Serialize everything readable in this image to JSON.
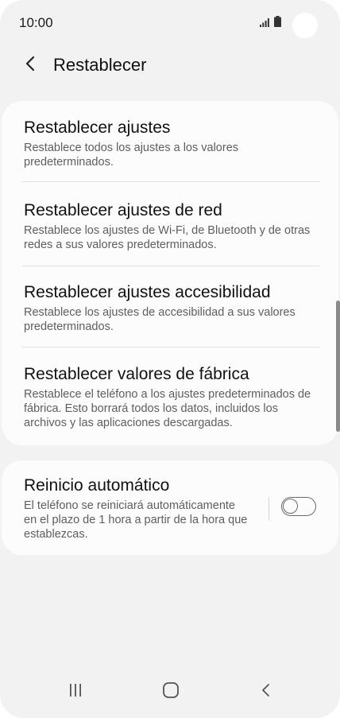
{
  "status_bar": {
    "time": "10:00",
    "icons": [
      "signal-icon",
      "battery-icon"
    ]
  },
  "header": {
    "back_icon": "chevron-left-icon",
    "title": "Restablecer"
  },
  "reset_options": [
    {
      "title": "Restablecer ajustes",
      "description": "Restablece todos los ajustes a los valores predeterminados."
    },
    {
      "title": "Restablecer ajustes de red",
      "description": "Restablece los ajustes de Wi-Fi, de Bluetooth y de otras redes a sus valores predeterminados."
    },
    {
      "title": "Restablecer ajustes accesibilidad",
      "description": "Restablece los ajustes de accesibilidad a sus valores predeterminados."
    },
    {
      "title": "Restablecer valores de fábrica",
      "description": "Restablece el teléfono a los ajustes predeterminados de fábrica. Esto borrará todos los datos, incluidos los archivos y las aplicaciones descargadas."
    }
  ],
  "auto_restart": {
    "title": "Reinicio automático",
    "description": "El teléfono se reiniciará automáticamente en el plazo de 1 hora a partir de la hora que establezcas.",
    "enabled": false
  },
  "nav_bar": {
    "buttons": [
      "recents-icon",
      "home-icon",
      "back-icon"
    ]
  },
  "colors": {
    "background": "#f2f2f2",
    "card": "#fcfcfc",
    "description_text": "#5e5e5e",
    "divider": "#e1e1e1"
  }
}
